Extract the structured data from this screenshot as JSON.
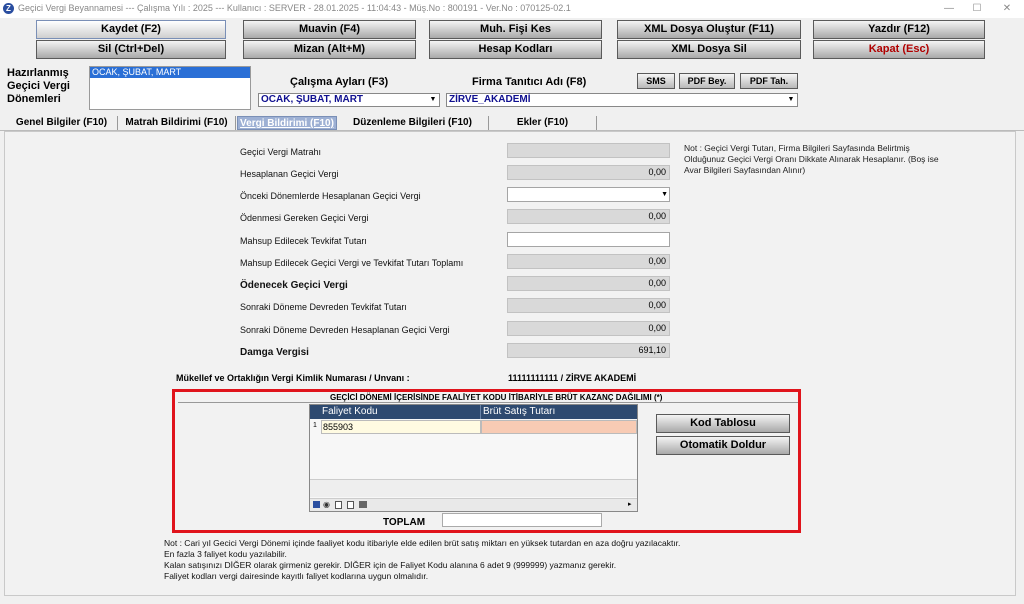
{
  "window": {
    "title": "Geçici Vergi Beyannamesi  ---  Çalışma Yılı : 2025  ---  Kullanıcı : SERVER - 28.01.2025 - 11:04:43 - Müş.No : 800191 - Ver.No : 070125-02.1",
    "icon_letter": "Z",
    "minimize": "—",
    "maximize": "☐",
    "close": "✕"
  },
  "toolbar": {
    "kaydet": "Kaydet (F2)",
    "muavin": "Muavin (F4)",
    "muh_fisi": "Muh. Fişi Kes",
    "xml_olustur": "XML Dosya Oluştur (F11)",
    "yazdir": "Yazdır (F12)",
    "sil": "Sil (Ctrl+Del)",
    "mizan": "Mizan (Alt+M)",
    "hesap_kodlari": "Hesap Kodları",
    "xml_sil": "XML Dosya Sil",
    "kapat": "Kapat (Esc)"
  },
  "top": {
    "hazirlanmis_label_1": "Hazırlanmış",
    "hazirlanmis_label_2": "Geçici Vergi",
    "hazirlanmis_label_3": "Dönemleri",
    "donem_list_item": "OCAK, ŞUBAT, MART",
    "calisma_aylari_label": "Çalışma Ayları (F3)",
    "calisma_aylari_value": "OCAK, ŞUBAT, MART",
    "firma_label": "Firma Tanıtıcı Adı (F8)",
    "firma_value": "ZİRVE_AKADEMİ",
    "sms": "SMS",
    "pdf_bey": "PDF Bey.",
    "pdf_tah": "PDF Tah."
  },
  "tabs": [
    "Genel Bilgiler (F10)",
    "Matrah Bildirimi (F10)",
    "Vergi Bildirimi (F10)",
    "Düzenleme Bilgileri  (F10)",
    "Ekler (F10)"
  ],
  "form": {
    "rows": [
      {
        "label": "Geçici Vergi Matrahı",
        "value": ""
      },
      {
        "label": "Hesaplanan Geçici Vergi",
        "value": "0,00"
      },
      {
        "label": "Önceki Dönemlerde Hesaplanan Geçici Vergi",
        "value": ""
      },
      {
        "label": "Ödenmesi Gereken Geçici Vergi",
        "value": "0,00"
      },
      {
        "label": "Mahsup Edilecek Tevkifat Tutarı",
        "value": ""
      },
      {
        "label": "Mahsup Edilecek Geçici Vergi ve Tevkifat Tutarı Toplamı",
        "value": "0,00"
      },
      {
        "label": "Ödenecek Geçici Vergi",
        "value": "0,00"
      },
      {
        "label": "Sonraki Döneme Devreden Tevkifat Tutarı",
        "value": "0,00"
      },
      {
        "label": "Sonraki Döneme Devreden Hesaplanan Geçici Vergi",
        "value": "0,00"
      },
      {
        "label": "Damga Vergisi",
        "value": "691,10"
      }
    ],
    "note_line1": "Not : Geçici Vergi Tutarı, Firma Bilgileri Sayfasında Belirtmiş",
    "note_line2": "Olduğunuz Geçici Vergi Oranı Dikkate Alınarak Hesaplanır. (Boş ise",
    "note_line3": "Avar Bilgileri Sayfasından Alınır)",
    "mukellef_label": "Mükellef ve Ortaklığın Vergi Kimlik Numarası / Unvanı :",
    "mukellef_value": "11111111111 / ZİRVE AKADEMİ"
  },
  "faaliyet": {
    "title": "GEÇİCİ DÖNEMİ İÇERİSİNDE FAALİYET KODU İTİBARİYLE BRÜT KAZANÇ DAĞILIMI (*)",
    "col_kod": "Faliyet Kodu",
    "col_tutar": "Brüt Satış Tutarı",
    "row_index": "1",
    "row_kod": "855903",
    "row_tutar": "",
    "kod_tablosu": "Kod Tablosu",
    "otomatik_doldur": "Otomatik Doldur",
    "toplam_label": "TOPLAM",
    "toplam_value": ""
  },
  "footer_notes": [
    "Not : Cari yıl Gecici Vergi Dönemi içinde faaliyet kodu itibariyle elde edilen brüt satış miktarı en yüksek tutardan en aza doğru yazılacaktır.",
    "En fazla 3 faliyet kodu yazılabilir.",
    "Kalan satışınızı DİĞER olarak girmeniz gerekir. DİĞER için de Faliyet Kodu alanına 6 adet 9 (999999) yazmanız gerekir.",
    "Faliyet kodları vergi dairesinde kayıtlı faliyet kodlarına uygun olmalıdır."
  ],
  "colors": {
    "highlight_border": "#e0141c",
    "grid_header": "#2e4a70",
    "tab_active": "#9db0d4"
  }
}
